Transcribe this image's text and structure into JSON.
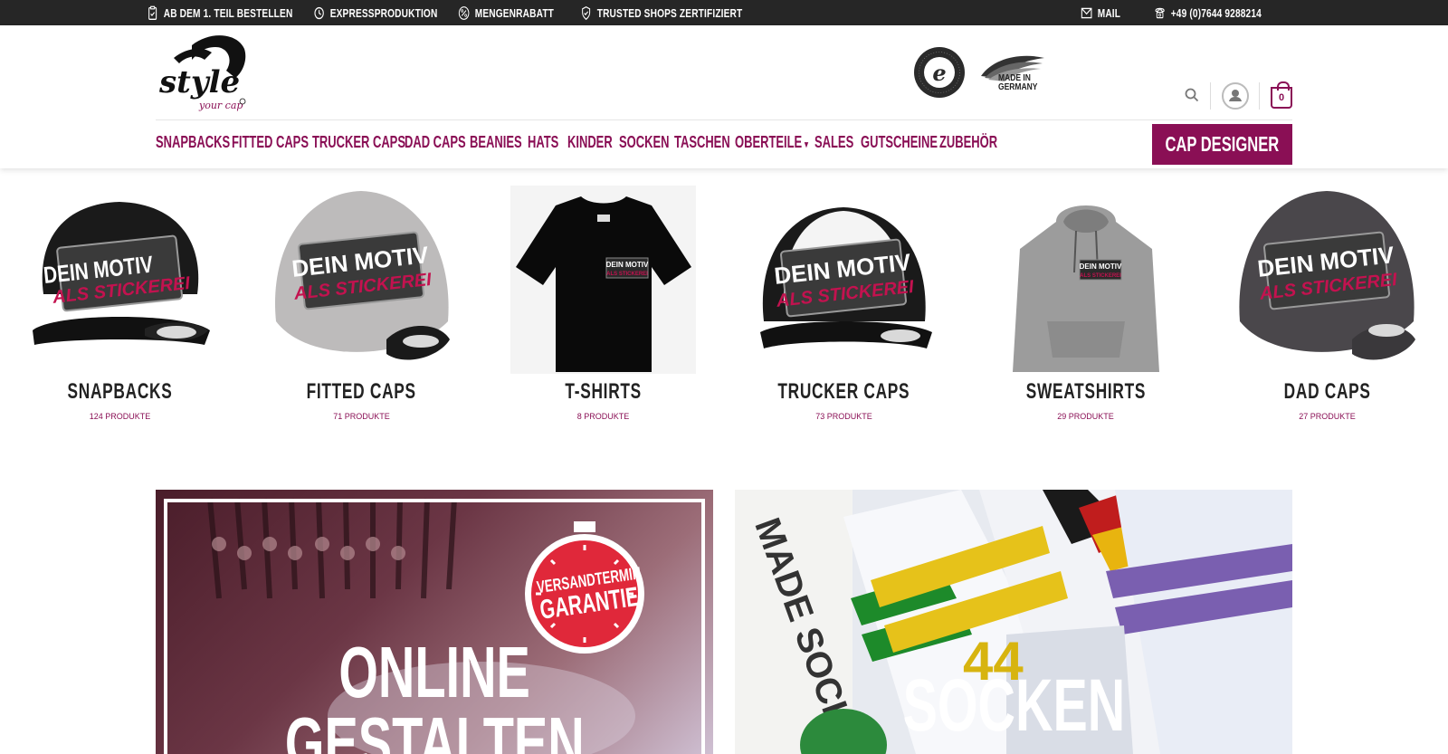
{
  "topbar": {
    "items": [
      {
        "label": "AB DEM 1. TEIL BESTELLEN",
        "icon": "clipboard-icon"
      },
      {
        "label": "EXPRESSPRODUKTION",
        "icon": "clock-icon"
      },
      {
        "label": "MENGENRABATT",
        "icon": "percent-icon"
      },
      {
        "label": "TRUSTED SHOPS ZERTIFIZIERT",
        "icon": "shield-icon"
      },
      {
        "label": "MAIL",
        "icon": "mail-icon"
      },
      {
        "label": "+49 (0)7644 9288214",
        "icon": "phone-icon"
      }
    ]
  },
  "header": {
    "logo_text": "style your cap",
    "badge_made_in": "MADE IN\nGERMANY",
    "cart_count": "0"
  },
  "nav": {
    "items": [
      "SNAPBACKS",
      "FITTED CAPS",
      "TRUCKER CAPS",
      "DAD CAPS",
      "BEANIES",
      "HATS",
      "KINDER",
      "SOCKEN",
      "TASCHEN",
      "OBERTEILE",
      "SALES",
      "GUTSCHEINE",
      "ZUBEHÖR"
    ],
    "cta": "CAP DESIGNER"
  },
  "categories": [
    {
      "title": "SNAPBACKS",
      "count": "124 PRODUKTE",
      "kind": "snapback-black"
    },
    {
      "title": "FITTED CAPS",
      "count": "71 PRODUKTE",
      "kind": "fitted-grey"
    },
    {
      "title": "T-SHIRTS",
      "count": "8 PRODUKTE",
      "kind": "tshirt-black"
    },
    {
      "title": "TRUCKER CAPS",
      "count": "73 PRODUKTE",
      "kind": "trucker-white"
    },
    {
      "title": "SWEATSHIRTS",
      "count": "29 PRODUKTE",
      "kind": "hoodie-grey"
    },
    {
      "title": "DAD CAPS",
      "count": "27 PRODUKTE",
      "kind": "dadcap-grey"
    }
  ],
  "patch": {
    "line1": "DEIN MOTIV",
    "line2": "ALS STICKEREI"
  },
  "banners": {
    "left": {
      "line1": "ONLINE",
      "line2": "GESTALTEN",
      "badge1": "VERSANDTERMIN",
      "badge2": "GARANTIE"
    },
    "right": {
      "title": "SOCKEN",
      "sub": "MADE SOCKS",
      "number": "44"
    }
  },
  "colors": {
    "brand": "#8a0f55",
    "topbar": "#262626",
    "badge_red": "#e0283a"
  }
}
